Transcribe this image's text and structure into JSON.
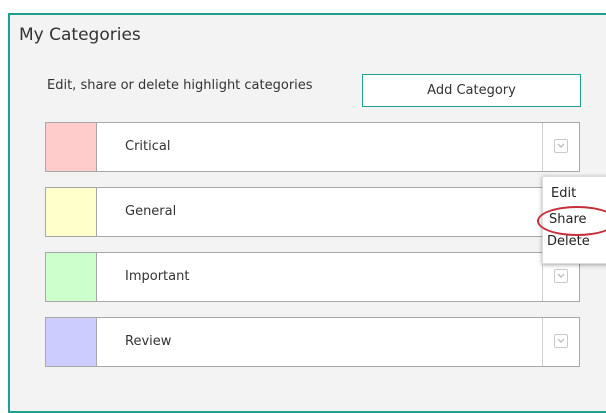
{
  "header": {
    "title": "My Categories",
    "subtitle": "Edit, share or delete highlight categories",
    "add_button": "Add Category"
  },
  "categories": [
    {
      "label": "Critical",
      "color": "#ffcccc"
    },
    {
      "label": "General",
      "color": "#ffffcc"
    },
    {
      "label": "Important",
      "color": "#ccffcc"
    },
    {
      "label": "Review",
      "color": "#ccccff"
    }
  ],
  "menu": {
    "items": [
      "Edit",
      "Share",
      "Delete"
    ]
  },
  "colors": {
    "accent": "#1f9f8c",
    "highlight_circle": "#c62f3a"
  }
}
